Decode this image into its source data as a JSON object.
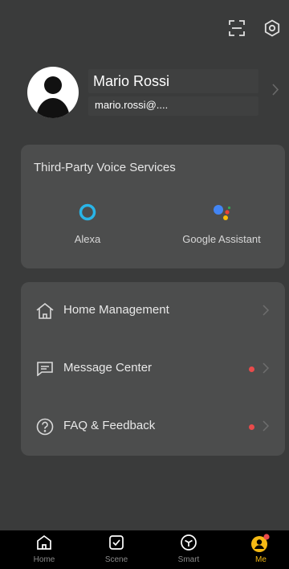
{
  "profile": {
    "name": "Mario Rossi",
    "email": "mario.rossi@...."
  },
  "voice_services": {
    "title": "Third-Party Voice Services",
    "items": [
      {
        "label": "Alexa",
        "icon": "alexa-icon"
      },
      {
        "label": "Google Assistant",
        "icon": "google-assistant-icon"
      }
    ]
  },
  "menu": {
    "items": [
      {
        "label": "Home Management",
        "icon": "home-outline-icon",
        "has_dot": false
      },
      {
        "label": "Message Center",
        "icon": "message-icon",
        "has_dot": true
      },
      {
        "label": "FAQ & Feedback",
        "icon": "question-icon",
        "has_dot": true
      }
    ]
  },
  "tabbar": {
    "items": [
      {
        "label": "Home",
        "icon": "home-icon",
        "active": false
      },
      {
        "label": "Scene",
        "icon": "checkbox-icon",
        "active": false
      },
      {
        "label": "Smart",
        "icon": "cube-icon",
        "active": false
      },
      {
        "label": "Me",
        "icon": "user-icon",
        "active": true
      }
    ]
  },
  "colors": {
    "background": "#3a3b3b",
    "card": "#4c4d4d",
    "accent": "#f5b914",
    "badge": "#e94b4b",
    "alexa": "#29b5e8"
  }
}
